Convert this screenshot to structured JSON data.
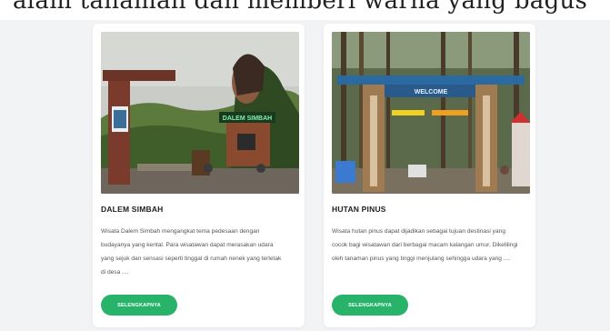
{
  "colors": {
    "page_bg": "#f2f3f5",
    "card_bg": "#ffffff",
    "button": "#27b36a",
    "title_text": "#1e1e1e",
    "body_text": "#555555"
  },
  "cards": [
    {
      "title": "DALEM SIMBAH",
      "photo_sign": "DALEM SIMBAH",
      "description": "Wisata Dalem Simbah mengangkat tema pedesaan dengan budayanya yang kental. Para wisatawan dapat merasakan udara yang sejuk dan sensasi seperti tinggal di rumah nenek yang terletak di desa ....",
      "button_label": "SELENGKAPNYA"
    },
    {
      "title": "HUTAN PINUS",
      "photo_sign": "WELCOME",
      "description": "Wisata hutan pinus dapat dijadikan sebagai tujuan destinasi yang cocok bagi wisatawan dari berbagai macam kalangan umur. Dikelilingi oleh tanaman pinus yang tinggi menjulang sehingga udara yang ....",
      "button_label": "SELENGKAPNYA"
    }
  ]
}
